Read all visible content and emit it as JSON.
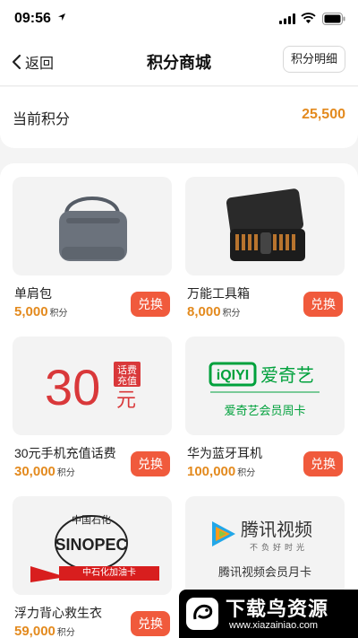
{
  "status_bar": {
    "time": "09:56",
    "icons": [
      "location-arrow-icon",
      "signal-icon",
      "wifi-icon",
      "battery-icon"
    ]
  },
  "nav": {
    "back_label": "返回",
    "title": "积分商城",
    "detail_label": "积分明细"
  },
  "points": {
    "label": "当前积分",
    "value": "25,500"
  },
  "colors": {
    "accent_orange": "#e38a1e",
    "redeem_red": "#f05a3c",
    "iqiyi_green": "#00a13c"
  },
  "items": [
    {
      "name": "单肩包",
      "price": "5,000",
      "unit": "积分",
      "button": "兑换"
    },
    {
      "name": "万能工具箱",
      "price": "8,000",
      "unit": "积分",
      "button": "兑换"
    },
    {
      "name": "30元手机充值话费",
      "price": "30,000",
      "unit": "积分",
      "button": "兑换",
      "image_text": {
        "amount": "30",
        "tag_line1": "话费",
        "tag_line2": "充值",
        "currency": "元"
      }
    },
    {
      "name": "华为蓝牙耳机",
      "price": "100,000",
      "unit": "积分",
      "button": "兑换",
      "image_text": {
        "brand": "爱奇艺",
        "card": "爱奇艺会员周卡"
      }
    },
    {
      "name": "浮力背心救生衣",
      "price": "59,000",
      "unit": "积分",
      "button": "兑换",
      "image_text": {
        "brand": "中国石化",
        "card": "中石化加油卡"
      }
    },
    {
      "name": "",
      "price": "",
      "unit": "",
      "button": "",
      "image_text": {
        "brand": "腾讯视频",
        "slogan": "不负好时光",
        "card": "腾讯视频会员月卡"
      }
    }
  ],
  "watermark": {
    "title": "下载鸟资源",
    "url": "www.xiazainiao.com"
  }
}
